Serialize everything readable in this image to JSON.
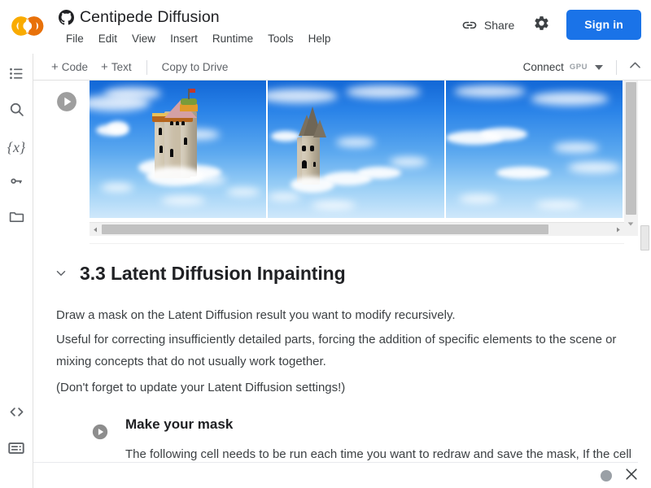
{
  "header": {
    "logo_icon": "colab-logo",
    "github_icon": "github-icon",
    "notebook_title": "Centipede Diffusion",
    "menu": [
      {
        "label": "File"
      },
      {
        "label": "Edit"
      },
      {
        "label": "View"
      },
      {
        "label": "Insert"
      },
      {
        "label": "Runtime"
      },
      {
        "label": "Tools"
      },
      {
        "label": "Help"
      }
    ],
    "share_label": "Share",
    "share_icon": "link-icon",
    "settings_icon": "gear-icon",
    "signin_label": "Sign in"
  },
  "toolbar": {
    "add_code_label": "Code",
    "add_text_label": "Text",
    "plus_glyph": "+",
    "copy_to_drive_label": "Copy to Drive",
    "connect_label": "Connect",
    "connect_badge": "GPU",
    "dropdown_icon": "chevron-down-icon",
    "collapse_icon": "chevron-up-icon"
  },
  "sidebar": {
    "items": [
      {
        "name": "table-of-contents",
        "icon": "list-icon"
      },
      {
        "name": "find-and-replace",
        "icon": "search-icon"
      },
      {
        "name": "variables",
        "icon": "variables-icon",
        "glyph": "{x}"
      },
      {
        "name": "secrets",
        "icon": "key-icon"
      },
      {
        "name": "files",
        "icon": "folder-icon"
      },
      {
        "name": "code-snippets",
        "icon": "code-brackets-icon",
        "glyph": "<>"
      },
      {
        "name": "terminal",
        "icon": "terminal-icon"
      }
    ]
  },
  "output_cell": {
    "run_icon": "play-circle-icon",
    "images": [
      {
        "alt": "castle-in-clouds-1"
      },
      {
        "alt": "castle-in-clouds-2"
      },
      {
        "alt": "sky-with-clouds-3"
      }
    ],
    "hscroll": {
      "left_arrow_icon": "caret-left-icon",
      "right_arrow_icon": "caret-right-icon"
    },
    "vscroll": {
      "down_arrow_icon": "caret-down-icon"
    }
  },
  "section": {
    "collapse_icon": "chevron-down-icon",
    "heading": "3.3 Latent Diffusion Inpainting",
    "paragraphs": [
      "Draw a mask on the Latent Diffusion result you want to modify recursively.",
      "Useful for correcting insufficiently detailed parts, forcing the addition of specific elements to the scene or mixing concepts that do not usually work together.",
      "(Don't forget to update your Latent Diffusion settings!)"
    ]
  },
  "subsection": {
    "run_icon": "play-circle-icon",
    "title": "Make your mask",
    "text": "The following cell needs to be run each time you want to redraw and save the mask, If the cell"
  },
  "statusbar": {
    "busy_indicator_icon": "circle-icon",
    "close_icon": "close-icon"
  },
  "colors": {
    "accent_blue": "#1a73e8",
    "logo_orange": "#f9ab00",
    "text_primary": "#202124",
    "text_secondary": "#3c4043",
    "icon_grey": "#5f6368",
    "scroll_thumb": "#c1c1c1"
  }
}
